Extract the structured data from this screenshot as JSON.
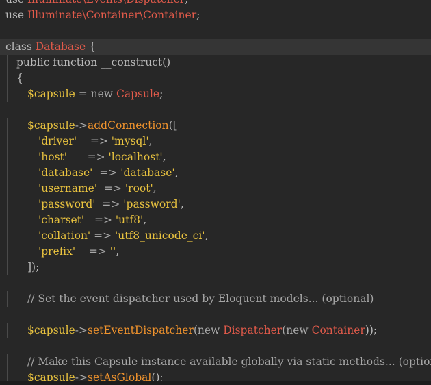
{
  "colors": {
    "background": "#272727",
    "current_line": "#353535",
    "keyword": "#b9b9b9",
    "plain": "#b9b9b9",
    "classname": "#e05a4a",
    "variable": "#e8c23f",
    "method": "#f0932d",
    "string": "#e8c23f",
    "operator": "#a8a8a8",
    "comment": "#a6a6a6"
  },
  "lines": [
    {
      "indent": 0,
      "tokens": [
        {
          "t": "use ",
          "c": "keyword"
        },
        {
          "t": "Illuminate\\Events\\Dispatcher",
          "c": "classname"
        },
        {
          "t": ";",
          "c": "plain"
        }
      ]
    },
    {
      "indent": 0,
      "tokens": [
        {
          "t": "use ",
          "c": "keyword"
        },
        {
          "t": "Illuminate\\Container\\Container",
          "c": "classname"
        },
        {
          "t": ";",
          "c": "plain"
        }
      ]
    },
    {
      "indent": 0,
      "tokens": []
    },
    {
      "indent": 0,
      "current": true,
      "tokens": [
        {
          "t": "class ",
          "c": "keyword"
        },
        {
          "t": "Database",
          "c": "classname"
        },
        {
          "t": " {",
          "c": "plain"
        }
      ]
    },
    {
      "indent": 1,
      "tokens": [
        {
          "t": "public function __construct()",
          "c": "keyword"
        }
      ]
    },
    {
      "indent": 1,
      "tokens": [
        {
          "t": "{",
          "c": "plain"
        }
      ]
    },
    {
      "indent": 2,
      "tokens": [
        {
          "t": "$capsule",
          "c": "variable"
        },
        {
          "t": " = new ",
          "c": "operator"
        },
        {
          "t": "Capsule",
          "c": "classname"
        },
        {
          "t": ";",
          "c": "plain"
        }
      ]
    },
    {
      "indent": 0,
      "tokens": []
    },
    {
      "indent": 2,
      "tokens": [
        {
          "t": "$capsule",
          "c": "variable"
        },
        {
          "t": "->",
          "c": "operator"
        },
        {
          "t": "addConnection",
          "c": "method"
        },
        {
          "t": "([",
          "c": "plain"
        }
      ]
    },
    {
      "indent": 3,
      "tokens": [
        {
          "t": "'driver'",
          "c": "string"
        },
        {
          "t": "    => ",
          "c": "operator"
        },
        {
          "t": "'mysql'",
          "c": "string"
        },
        {
          "t": ",",
          "c": "plain"
        }
      ]
    },
    {
      "indent": 3,
      "tokens": [
        {
          "t": "'host'",
          "c": "string"
        },
        {
          "t": "      => ",
          "c": "operator"
        },
        {
          "t": "'localhost'",
          "c": "string"
        },
        {
          "t": ",",
          "c": "plain"
        }
      ]
    },
    {
      "indent": 3,
      "tokens": [
        {
          "t": "'database'",
          "c": "string"
        },
        {
          "t": "  => ",
          "c": "operator"
        },
        {
          "t": "'database'",
          "c": "string"
        },
        {
          "t": ",",
          "c": "plain"
        }
      ]
    },
    {
      "indent": 3,
      "tokens": [
        {
          "t": "'username'",
          "c": "string"
        },
        {
          "t": "  => ",
          "c": "operator"
        },
        {
          "t": "'root'",
          "c": "string"
        },
        {
          "t": ",",
          "c": "plain"
        }
      ]
    },
    {
      "indent": 3,
      "tokens": [
        {
          "t": "'password'",
          "c": "string"
        },
        {
          "t": "  => ",
          "c": "operator"
        },
        {
          "t": "'password'",
          "c": "string"
        },
        {
          "t": ",",
          "c": "plain"
        }
      ]
    },
    {
      "indent": 3,
      "tokens": [
        {
          "t": "'charset'",
          "c": "string"
        },
        {
          "t": "   => ",
          "c": "operator"
        },
        {
          "t": "'utf8'",
          "c": "string"
        },
        {
          "t": ",",
          "c": "plain"
        }
      ]
    },
    {
      "indent": 3,
      "tokens": [
        {
          "t": "'collation'",
          "c": "string"
        },
        {
          "t": " => ",
          "c": "operator"
        },
        {
          "t": "'utf8_unicode_ci'",
          "c": "string"
        },
        {
          "t": ",",
          "c": "plain"
        }
      ]
    },
    {
      "indent": 3,
      "tokens": [
        {
          "t": "'prefix'",
          "c": "string"
        },
        {
          "t": "    => ",
          "c": "operator"
        },
        {
          "t": "''",
          "c": "string"
        },
        {
          "t": ",",
          "c": "plain"
        }
      ]
    },
    {
      "indent": 2,
      "tokens": [
        {
          "t": "]);",
          "c": "plain"
        }
      ]
    },
    {
      "indent": 0,
      "tokens": []
    },
    {
      "indent": 2,
      "tokens": [
        {
          "t": "// Set the event dispatcher used by Eloquent models... (optional)",
          "c": "comment"
        }
      ]
    },
    {
      "indent": 0,
      "tokens": []
    },
    {
      "indent": 2,
      "tokens": [
        {
          "t": "$capsule",
          "c": "variable"
        },
        {
          "t": "->",
          "c": "operator"
        },
        {
          "t": "setEventDispatcher",
          "c": "method"
        },
        {
          "t": "(new ",
          "c": "operator"
        },
        {
          "t": "Dispatcher",
          "c": "classname"
        },
        {
          "t": "(new ",
          "c": "operator"
        },
        {
          "t": "Container",
          "c": "classname"
        },
        {
          "t": "));",
          "c": "plain"
        }
      ]
    },
    {
      "indent": 0,
      "tokens": []
    },
    {
      "indent": 2,
      "tokens": [
        {
          "t": "// Make this Capsule instance available globally via static methods... (optional)",
          "c": "comment"
        }
      ]
    },
    {
      "indent": 2,
      "tokens": [
        {
          "t": "$capsule",
          "c": "variable"
        },
        {
          "t": "->",
          "c": "operator"
        },
        {
          "t": "setAsGlobal",
          "c": "method"
        },
        {
          "t": "();",
          "c": "plain"
        }
      ]
    }
  ]
}
